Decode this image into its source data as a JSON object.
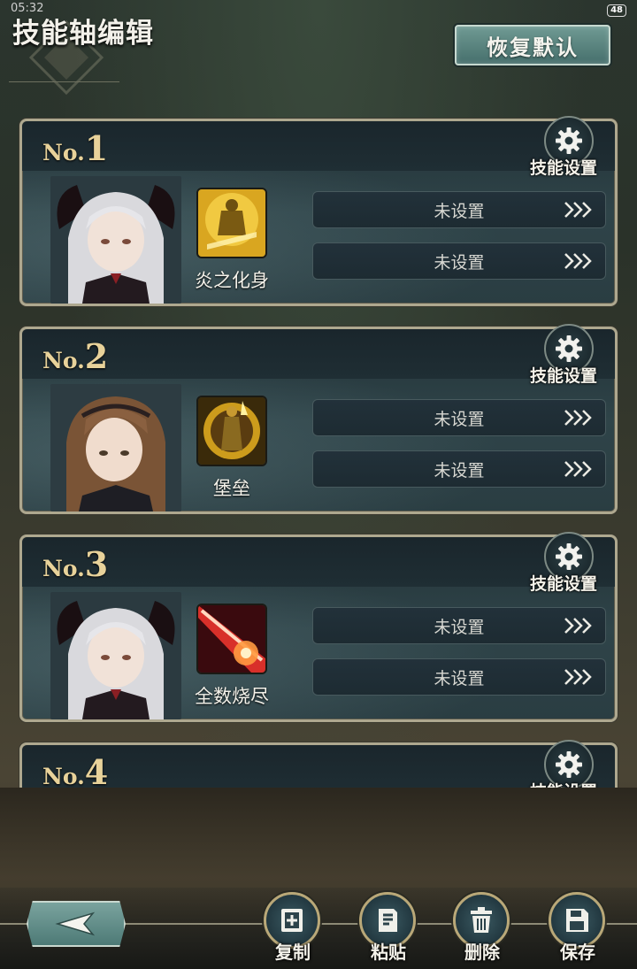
{
  "status": {
    "time": "05:32",
    "battery": "48"
  },
  "header": {
    "title": "技能轴编辑",
    "reset_label": "恢复默认"
  },
  "slots": [
    {
      "no_prefix": "No.",
      "no_num": "1",
      "gear_label": "技能设置",
      "skill_name": "炎之化身",
      "rows": [
        "未设置",
        "未设置"
      ]
    },
    {
      "no_prefix": "No.",
      "no_num": "2",
      "gear_label": "技能设置",
      "skill_name": "堡垒",
      "rows": [
        "未设置",
        "未设置"
      ]
    },
    {
      "no_prefix": "No.",
      "no_num": "3",
      "gear_label": "技能设置",
      "skill_name": "全数烧尽",
      "rows": [
        "未设置",
        "未设置"
      ]
    },
    {
      "no_prefix": "No.",
      "no_num": "4",
      "gear_label": "技能设置"
    }
  ],
  "toolbar": {
    "copy": "复制",
    "paste": "粘贴",
    "delete": "删除",
    "save": "保存"
  },
  "icons": {
    "settings": "gear-icon",
    "row_arrow": "triple-chevron-right-icon",
    "back": "back-arrow-icon",
    "copy": "copy-icon",
    "paste": "paste-icon",
    "delete": "trash-icon",
    "save": "floppy-disk-icon"
  },
  "colors": {
    "accent_teal": "#5f8c86",
    "gold": "#e8d29a",
    "frame": "#aea88f"
  }
}
